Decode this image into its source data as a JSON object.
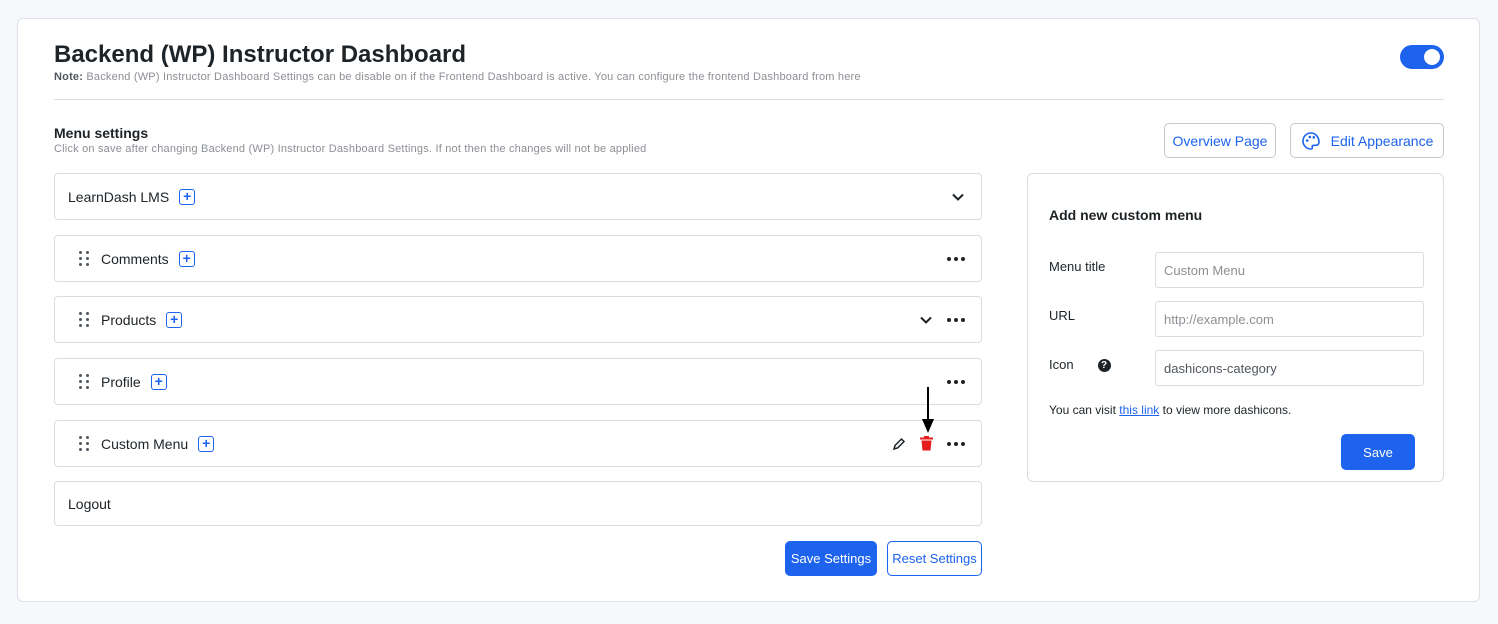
{
  "header": {
    "title": "Backend (WP) Instructor Dashboard",
    "note_label": "Note:",
    "note_text": "Backend (WP) Instructor Dashboard Settings can be disable on if the Frontend Dashboard is active. You can configure the frontend Dashboard from here",
    "toggle_enabled": true
  },
  "menu_settings": {
    "title": "Menu settings",
    "subtitle": "Click on save after changing Backend (WP) Instructor Dashboard Settings. If not then the changes will not be applied",
    "overview_button": "Overview Page",
    "appearance_button": "Edit Appearance"
  },
  "menu_items": [
    {
      "label": "LearnDash LMS"
    },
    {
      "label": "Comments"
    },
    {
      "label": "Products"
    },
    {
      "label": "Profile"
    },
    {
      "label": "Custom Menu"
    },
    {
      "label": "Logout"
    }
  ],
  "actions": {
    "save_settings": "Save Settings",
    "reset_settings": "Reset Settings"
  },
  "custom_menu_panel": {
    "title": "Add new custom menu",
    "menu_title_label": "Menu title",
    "menu_title_placeholder": "Custom Menu",
    "url_label": "URL",
    "url_placeholder": "http://example.com",
    "icon_label": "Icon",
    "icon_value": "dashicons-category",
    "info_prefix": "You can visit ",
    "info_link": "this link",
    "info_suffix": " to view more dashicons.",
    "save_button": "Save"
  },
  "colors": {
    "accent": "#1d63ed",
    "delete": "#e51c1c"
  }
}
